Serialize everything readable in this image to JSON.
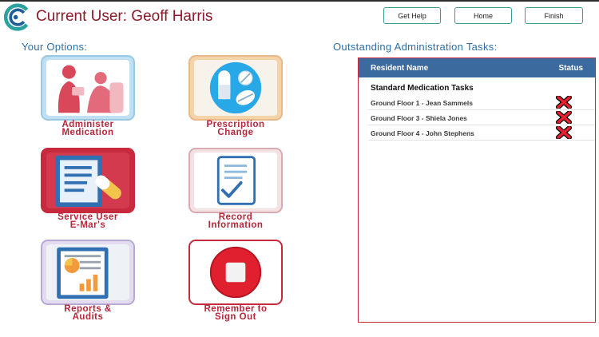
{
  "header": {
    "user_title": "Current User: Geoff Harris",
    "buttons": {
      "help": "Get Help",
      "home": "Home",
      "finish": "Finish"
    }
  },
  "options": {
    "heading": "Your Options:",
    "tiles": [
      {
        "line1": "Administer",
        "line2": "Medication"
      },
      {
        "line1": "Prescription",
        "line2": "Change"
      },
      {
        "line1": "Service User",
        "line2": "E-Mar's"
      },
      {
        "line1": "Record",
        "line2": "Information"
      },
      {
        "line1": "Reports &",
        "line2": "Audits"
      },
      {
        "line1": "Remember to",
        "line2": "Sign Out"
      }
    ]
  },
  "tasks": {
    "heading": "Outstanding Administration Tasks:",
    "columns": {
      "name": "Resident Name",
      "status": "Status"
    },
    "group": "Standard Medication Tasks",
    "rows": [
      {
        "name": "Ground Floor 1 - Jean Sammels",
        "status": "not-done"
      },
      {
        "name": "Ground Floor 3 - Shiela Jones",
        "status": "not-done"
      },
      {
        "name": "Ground Floor 4 - John Stephens",
        "status": "not-done"
      }
    ]
  },
  "colors": {
    "brand_red": "#c7293d",
    "title_red": "#8b1a28",
    "heading_blue": "#2e6fa7",
    "table_header": "#3b6a9e",
    "button_border": "#3a9e95"
  },
  "icons": [
    "app-logo",
    "nurse-patient-icon",
    "pills-icon",
    "emar-document-icon",
    "clipboard-check-icon",
    "report-chart-icon",
    "stop-icon",
    "red-cross-icon"
  ]
}
